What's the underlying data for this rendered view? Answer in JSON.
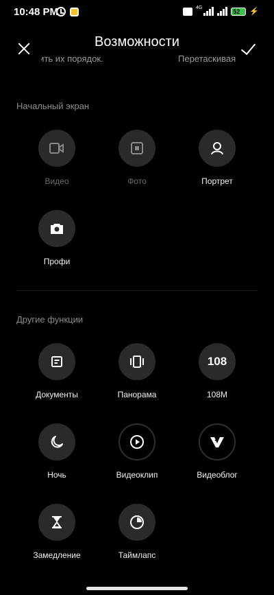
{
  "status_bar": {
    "time": "10:48 PM",
    "network_label": "4G",
    "battery_level": "52",
    "icons": [
      "alarm-icon",
      "app-icon",
      "volte-icon",
      "signal-icon",
      "battery-icon",
      "charging-icon"
    ]
  },
  "header": {
    "title": "Возможности",
    "close_icon": "close-icon",
    "confirm_icon": "checkmark-icon"
  },
  "hint": {
    "left": "нить их порядок.",
    "right": "Перетаскивая"
  },
  "home_screen": {
    "title": "Начальный экран",
    "items": [
      {
        "label": "Видео",
        "icon": "video-icon",
        "enabled": false
      },
      {
        "label": "Фото",
        "icon": "photo-icon",
        "enabled": false
      },
      {
        "label": "Портрет",
        "icon": "portrait-icon",
        "enabled": true
      },
      {
        "label": "Профи",
        "icon": "pro-camera-icon",
        "enabled": true
      }
    ]
  },
  "other_features": {
    "title": "Другие функции",
    "items": [
      {
        "label": "Документы",
        "icon": "document-icon"
      },
      {
        "label": "Панорама",
        "icon": "panorama-icon"
      },
      {
        "label": "108M",
        "icon": "108m-icon",
        "icon_text": "108"
      },
      {
        "label": "Ночь",
        "icon": "night-icon"
      },
      {
        "label": "Видеоклип",
        "icon": "videoclip-icon"
      },
      {
        "label": "Видеоблог",
        "icon": "vlog-icon"
      },
      {
        "label": "Замедление",
        "icon": "slow-motion-icon"
      },
      {
        "label": "Таймлапс",
        "icon": "timelapse-icon"
      }
    ]
  },
  "colors": {
    "background": "#000000",
    "icon_circle": "#2a2a2a",
    "battery": "#3fc04a",
    "section_title": "#8a8a8a"
  }
}
